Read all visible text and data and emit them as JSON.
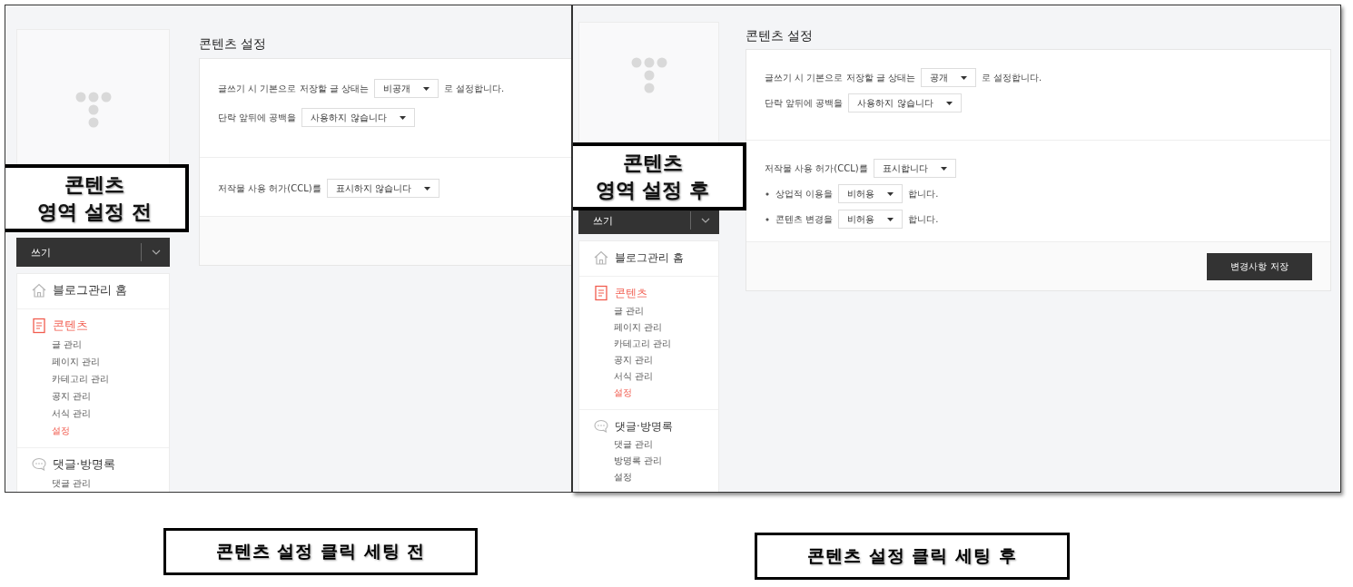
{
  "panels": [
    {
      "callout": [
        "콘텐츠",
        "영역 설정 전"
      ],
      "sidebar": {
        "write_button": "쓰기",
        "menu": [
          {
            "kind": "home",
            "label": "블로그관리 홈",
            "selected": false
          },
          {
            "kind": "document",
            "label": "콘텐츠",
            "selected": true,
            "children": [
              {
                "label": "글 관리",
                "selected": false
              },
              {
                "label": "페이지 관리",
                "selected": false
              },
              {
                "label": "카테고리 관리",
                "selected": false
              },
              {
                "label": "공지 관리",
                "selected": false
              },
              {
                "label": "서식 관리",
                "selected": false
              },
              {
                "label": "설정",
                "selected": true
              }
            ]
          },
          {
            "kind": "comment",
            "label": "댓글·방명록",
            "selected": false,
            "children": [
              {
                "label": "댓글 관리",
                "selected": false
              }
            ]
          }
        ]
      },
      "main": {
        "title": "콘텐츠 설정",
        "sections": [
          {
            "rows": [
              {
                "prefix": "글쓰기 시 기본으로 저장할 글 상태는",
                "value": "비공개",
                "suffix": "로 설정합니다.",
                "bullet": false
              },
              {
                "prefix": "단락 앞뒤에 공백을",
                "value": "사용하지 않습니다",
                "bullet": false
              }
            ]
          },
          {
            "rows": [
              {
                "prefix": "저작물 사용 허가(CCL)를",
                "value": "표시하지 않습니다",
                "bullet": false
              }
            ]
          }
        ]
      }
    },
    {
      "callout": [
        "콘텐츠",
        "영역 설정 후"
      ],
      "sidebar": {
        "write_button": "쓰기",
        "menu": [
          {
            "kind": "home",
            "label": "블로그관리 홈",
            "selected": false
          },
          {
            "kind": "document",
            "label": "콘텐츠",
            "selected": true,
            "children": [
              {
                "label": "글 관리",
                "selected": false
              },
              {
                "label": "페이지 관리",
                "selected": false
              },
              {
                "label": "카테고리 관리",
                "selected": false
              },
              {
                "label": "공지 관리",
                "selected": false
              },
              {
                "label": "서식 관리",
                "selected": false
              },
              {
                "label": "설정",
                "selected": true
              }
            ]
          },
          {
            "kind": "comment",
            "label": "댓글·방명록",
            "selected": false,
            "children": [
              {
                "label": "댓글 관리",
                "selected": false
              },
              {
                "label": "방명록 관리",
                "selected": false
              },
              {
                "label": "설정",
                "selected": false
              }
            ]
          }
        ]
      },
      "main": {
        "title": "콘텐츠 설정",
        "sections": [
          {
            "rows": [
              {
                "prefix": "글쓰기 시 기본으로 저장할 글 상태는",
                "value": "공개",
                "suffix": "로 설정합니다.",
                "bullet": false
              },
              {
                "prefix": "단락 앞뒤에 공백을",
                "value": "사용하지 않습니다",
                "bullet": false
              }
            ]
          },
          {
            "rows": [
              {
                "prefix": "저작물 사용 허가(CCL)를",
                "value": "표시합니다",
                "bullet": false
              },
              {
                "prefix": "상업적 이용을",
                "value": "비허용",
                "suffix": "합니다.",
                "bullet": true
              },
              {
                "prefix": "콘텐츠 변경을",
                "value": "비허용",
                "suffix": "합니다.",
                "bullet": true
              }
            ]
          }
        ],
        "save_button": "변경사항 저장"
      }
    }
  ],
  "captions": [
    "콘텐츠 설정 클릭 세팅 전",
    "콘텐츠 설정 클릭 세팅 후"
  ]
}
